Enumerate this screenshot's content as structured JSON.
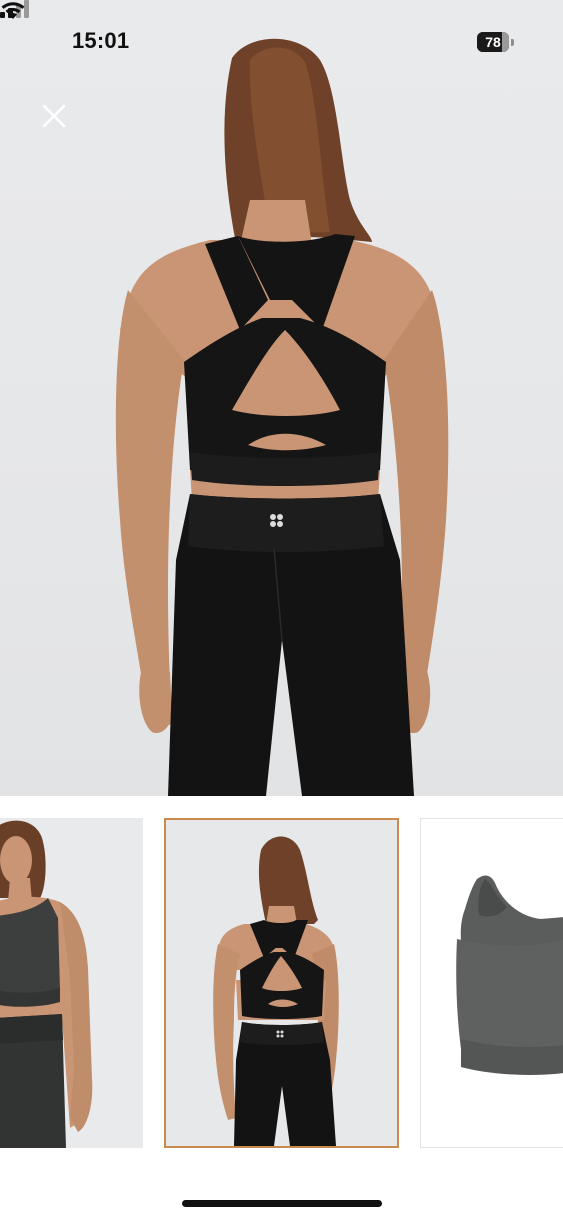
{
  "status_bar": {
    "time": "15:01",
    "signal_icon": "cellular-signal-icon",
    "wifi_icon": "wifi-icon",
    "battery_level": "78",
    "battery_fraction": 0.78
  },
  "viewer": {
    "close_icon": "close-icon",
    "main_image": "product-photo-back-view",
    "selected_thumbnail": 2
  },
  "thumbnails": [
    {
      "image": "model-front-grey-bra",
      "selected": false
    },
    {
      "image": "model-back-black-bra",
      "selected": true
    },
    {
      "image": "product-grey-bra",
      "selected": false
    }
  ],
  "colors": {
    "selected_border": "#c98a50",
    "background": "#e7e8ea"
  }
}
